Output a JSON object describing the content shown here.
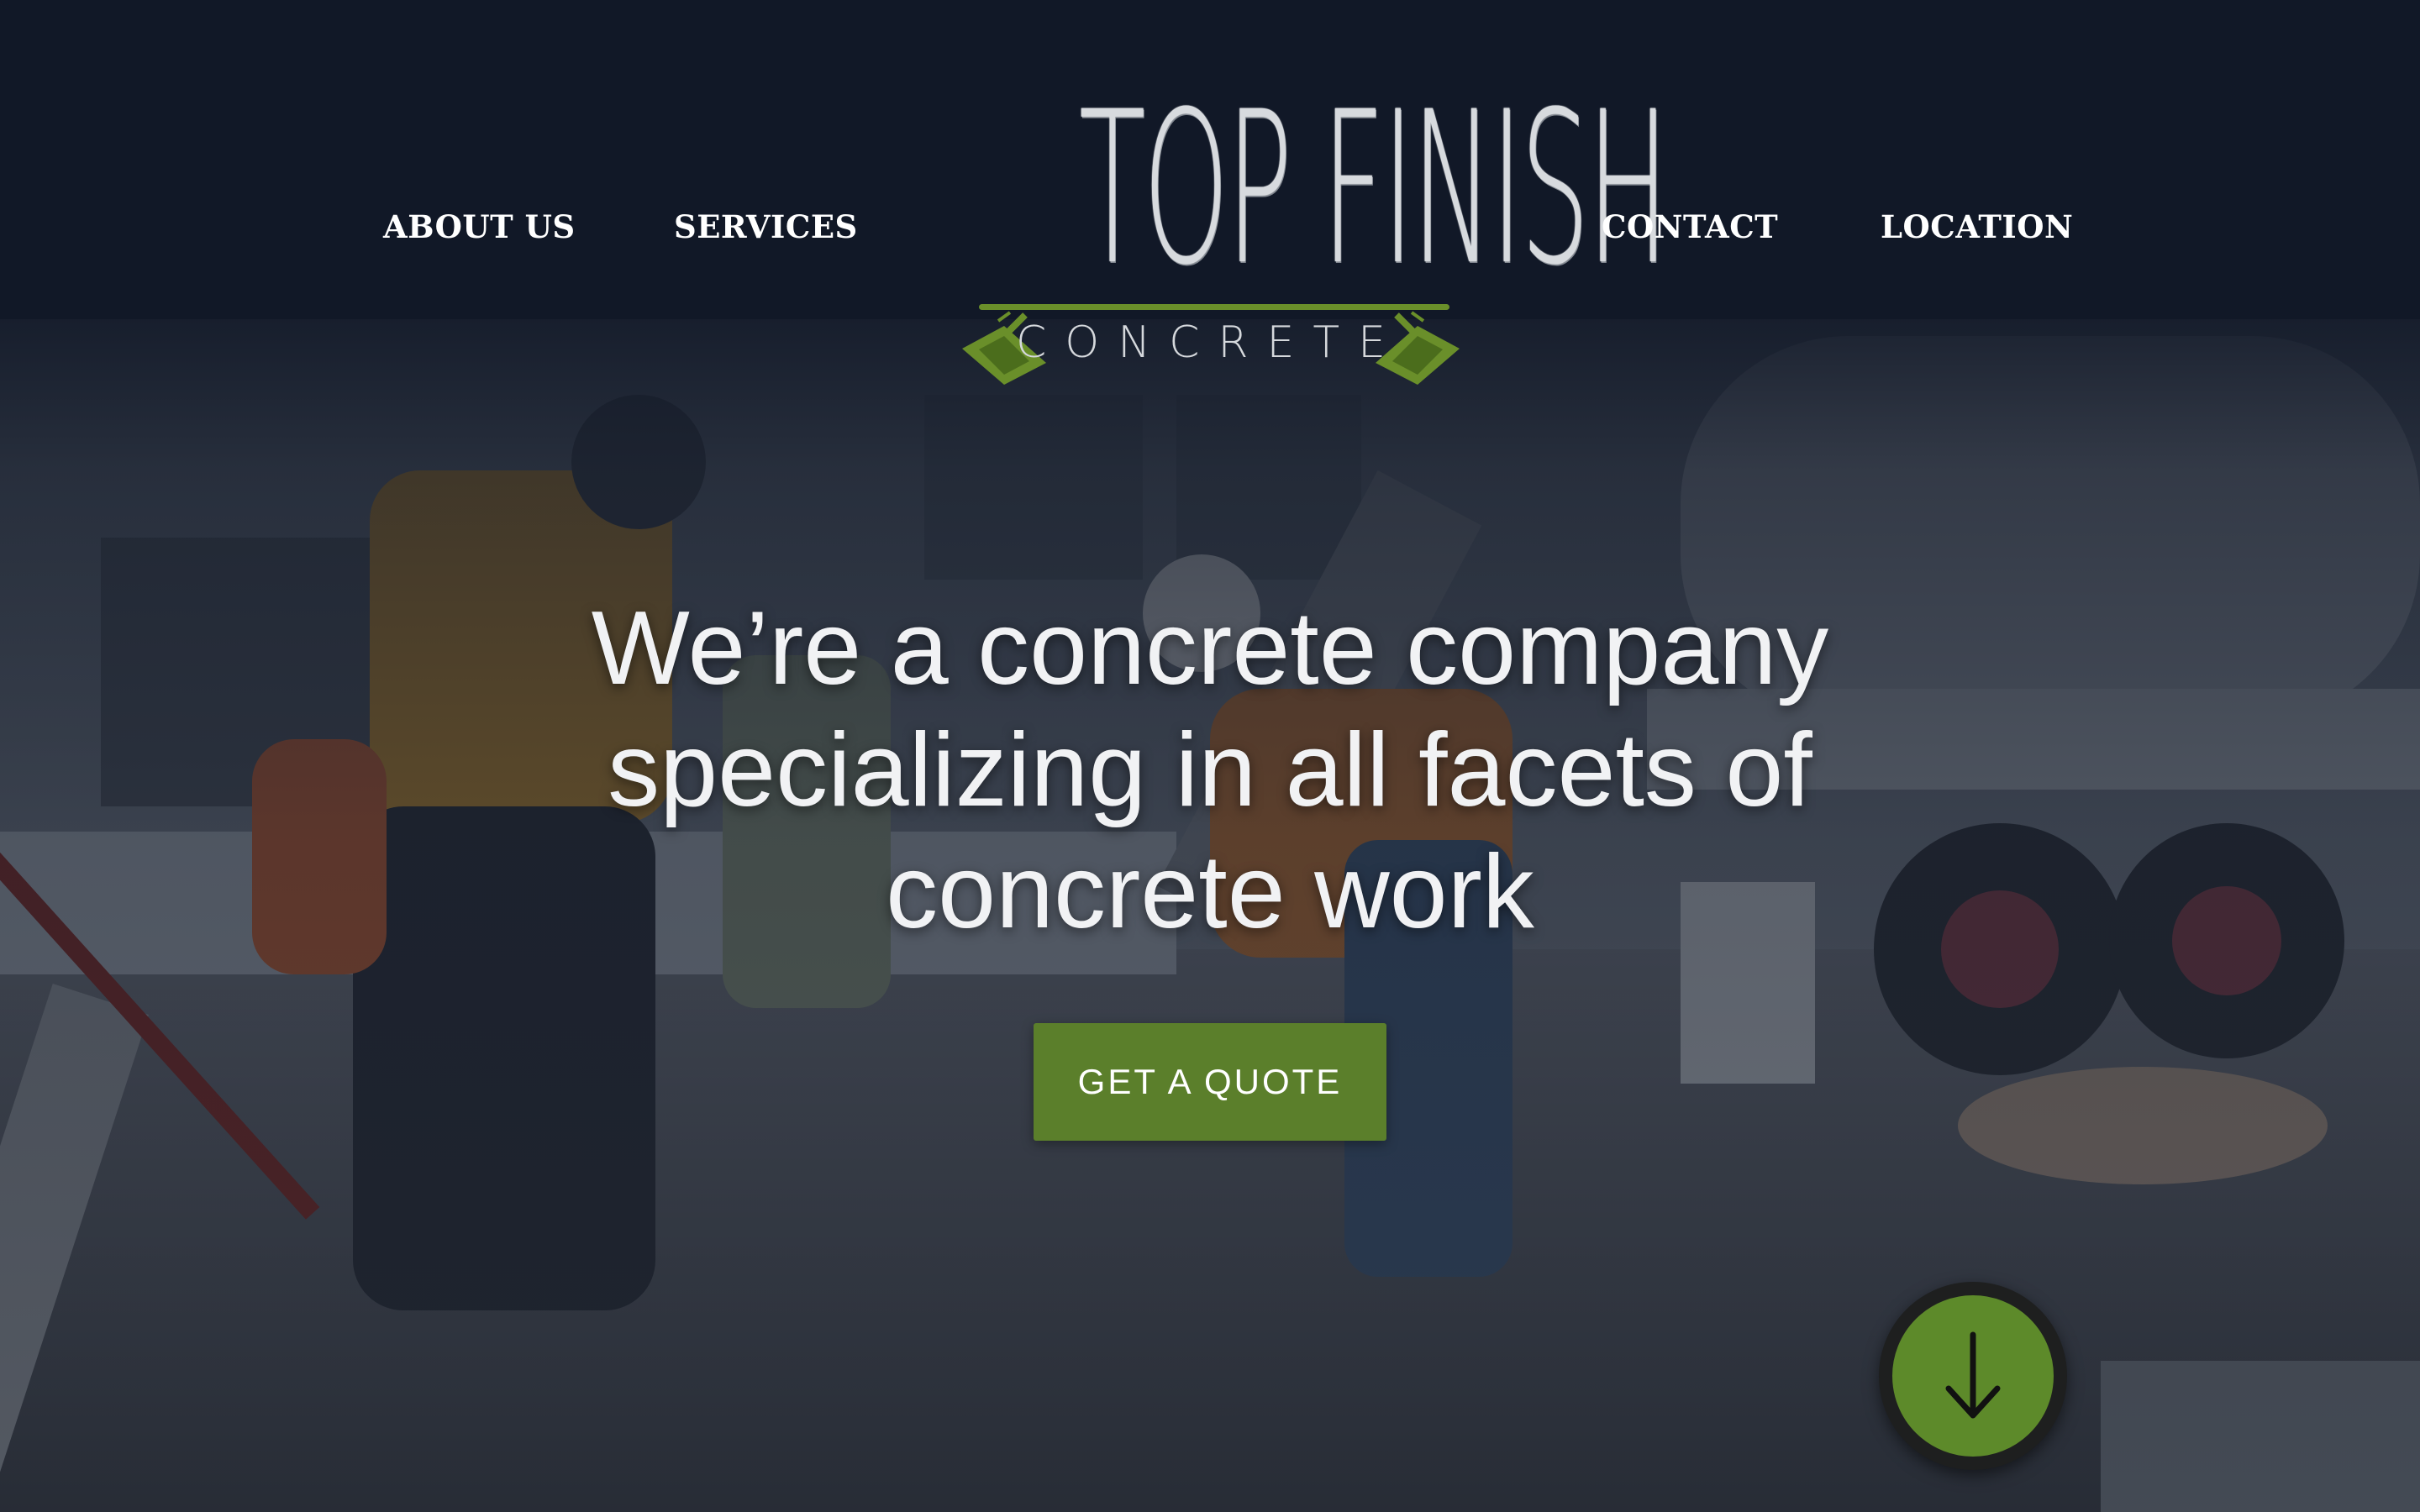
{
  "nav": {
    "items": [
      {
        "label": "ABOUT US"
      },
      {
        "label": "SERVICES"
      },
      {
        "label": "CONTACT"
      },
      {
        "label": "LOCATION"
      }
    ]
  },
  "logo": {
    "title": "TOP FINISH",
    "subtitle": "CONCRETE",
    "accent_color": "#6a8f2a"
  },
  "hero": {
    "headline": "We’re a concrete company specializing in all facets of concrete work",
    "cta_label": "GET A QUOTE",
    "cta_color": "#5b7f2b",
    "scroll_icon": "arrow-down-icon",
    "scroll_color": "#5d8a2a"
  }
}
